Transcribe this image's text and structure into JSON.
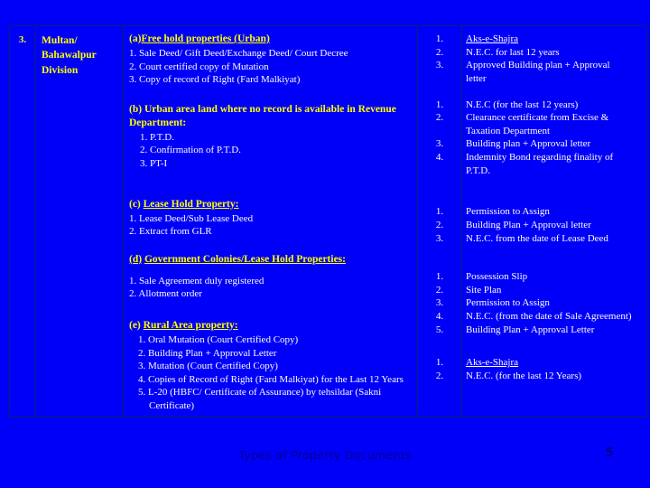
{
  "slide": {
    "background_color": "#0000f8",
    "heading_color": "#ffff00",
    "body_color": "#ffffff",
    "footer_color": "#00008b",
    "footer_title": "Types of Property Documents",
    "page_number": "5"
  },
  "row": {
    "serial_no": "3.",
    "division": "Multan/ Bahawalpur Division"
  },
  "groups": [
    {
      "id": "a",
      "tag": "(a)",
      "heading": "Free hold properties (Urban)",
      "items": [
        "1. Sale Deed/ Gift Deed/Exchange Deed/ Court Decree",
        "2. Court certified copy of Mutation",
        "3. Copy of record of Right (Fard Malkiyat)"
      ],
      "requirements": [
        {
          "num": "1.",
          "text": "Aks-e-Shajra"
        },
        {
          "num": "2.",
          "text": "N.E.C. for last 12 years"
        },
        {
          "num": "3.",
          "text": "Approved Building plan + Approval"
        },
        {
          "num": "",
          "text": "letter"
        }
      ]
    },
    {
      "id": "b",
      "tag": "(b)",
      "heading": "Urban area land where no record is available in Revenue Department:",
      "items": [
        "1. P.T.D.",
        "2. Confirmation of P.T.D.",
        "3. PT-I"
      ],
      "requirements": [
        {
          "num": "1.",
          "text": "N.E.C (for the last 12 years)"
        },
        {
          "num": "2.",
          "text": "Clearance certificate from Excise &"
        },
        {
          "num": "",
          "text": "Taxation Department"
        },
        {
          "num": "3.",
          "text": "Building plan + Approval letter"
        },
        {
          "num": "4.",
          "text": "Indemnity Bond regarding finality of"
        },
        {
          "num": "",
          "text": "P.T.D."
        }
      ]
    },
    {
      "id": "c",
      "tag": "(c)",
      "heading": "Lease Hold Property:",
      "items": [
        "1. Lease Deed/Sub Lease Deed",
        "2. Extract from GLR"
      ],
      "requirements": [
        {
          "num": "1.",
          "text": "Permission to Assign"
        },
        {
          "num": "2.",
          "text": "Building Plan + Approval letter"
        },
        {
          "num": "3.",
          "text": "N.E.C. from the date of Lease Deed"
        }
      ]
    },
    {
      "id": "d",
      "tag": "(d)",
      "heading": "Government Colonies/Lease Hold Properties:",
      "items": [
        "1. Sale Agreement duly registered",
        "2. Allotment order"
      ],
      "requirements": [
        {
          "num": "1.",
          "text": "Possession Slip"
        },
        {
          "num": "2.",
          "text": "Site Plan"
        },
        {
          "num": "3.",
          "text": "Permission to Assign"
        },
        {
          "num": "4.",
          "text": "N.E.C. (from the date of Sale Agreement)"
        },
        {
          "num": "5.",
          "text": "Building Plan + Approval Letter"
        }
      ]
    },
    {
      "id": "e",
      "tag": "(e)",
      "heading": "Rural Area property:",
      "items": [
        "1.  Oral Mutation (Court Certified Copy)",
        "2.  Building Plan + Approval Letter",
        "3.  Mutation (Court Certified Copy)",
        "4.  Copies of Record of Right (Fard Malkiyat) for   the Last 12 Years",
        "5.  L-20 (HBFC/ Certificate of Assurance) by tehsildar (Sakni Certificate)"
      ],
      "requirements": [
        {
          "num": "1.",
          "text": "Aks-e-Shajra"
        },
        {
          "num": "2.",
          "text": "N.E.C. (for the last 12 Years)"
        }
      ]
    }
  ]
}
